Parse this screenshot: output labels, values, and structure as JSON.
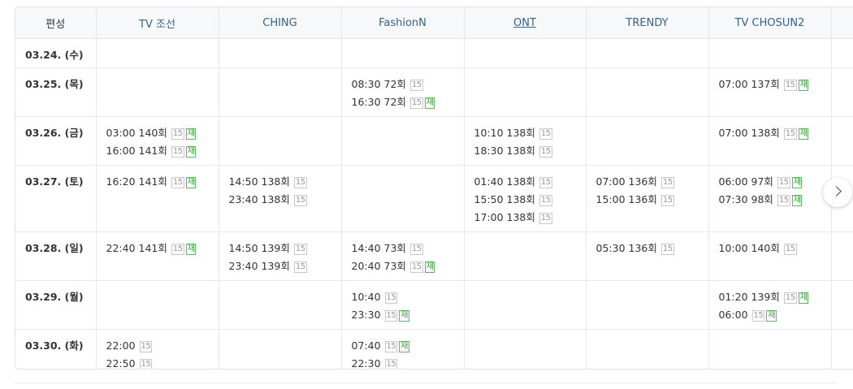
{
  "header": {
    "label": "편성",
    "channels": [
      "TV 조선",
      "CHING",
      "FashionN",
      "ONT",
      "TRENDY",
      "TV CHOSUN2",
      ""
    ]
  },
  "rows": [
    {
      "date": "03.24. (수)",
      "cells": [
        [],
        [],
        [],
        [],
        [],
        [],
        []
      ]
    },
    {
      "date": "03.25. (목)",
      "cells": [
        [],
        [],
        [
          {
            "time": "08:30",
            "ep": "72회",
            "rating": "15"
          },
          {
            "time": "16:30",
            "ep": "72회",
            "rating": "15",
            "rerun": "재"
          }
        ],
        [],
        [],
        [
          {
            "time": "07:00",
            "ep": "137회",
            "rating": "15",
            "rerun": "재"
          }
        ],
        []
      ]
    },
    {
      "date": "03.26. (금)",
      "cells": [
        [
          {
            "time": "03:00",
            "ep": "140회",
            "rating": "15",
            "rerun": "재"
          },
          {
            "time": "16:00",
            "ep": "141회",
            "rating": "15",
            "rerun": "재"
          }
        ],
        [],
        [],
        [
          {
            "time": "10:10",
            "ep": "138회",
            "rating": "15"
          },
          {
            "time": "18:30",
            "ep": "138회",
            "rating": "15"
          }
        ],
        [],
        [
          {
            "time": "07:00",
            "ep": "138회",
            "rating": "15",
            "rerun": "재"
          }
        ],
        []
      ]
    },
    {
      "date": "03.27. (토)",
      "cells": [
        [
          {
            "time": "16:20",
            "ep": "141회",
            "rating": "15",
            "rerun": "재"
          }
        ],
        [
          {
            "time": "14:50",
            "ep": "138회",
            "rating": "15"
          },
          {
            "time": "23:40",
            "ep": "138회",
            "rating": "15"
          }
        ],
        [],
        [
          {
            "time": "01:40",
            "ep": "138회",
            "rating": "15"
          },
          {
            "time": "15:50",
            "ep": "138회",
            "rating": "15"
          },
          {
            "time": "17:00",
            "ep": "138회",
            "rating": "15"
          }
        ],
        [
          {
            "time": "07:00",
            "ep": "136회",
            "rating": "15"
          },
          {
            "time": "15:00",
            "ep": "136회",
            "rating": "15"
          }
        ],
        [
          {
            "time": "06:00",
            "ep": "97회",
            "rating": "15",
            "rerun": "재"
          },
          {
            "time": "07:30",
            "ep": "98회",
            "rating": "15",
            "rerun": "재"
          }
        ],
        []
      ]
    },
    {
      "date": "03.28. (일)",
      "cells": [
        [
          {
            "time": "22:40",
            "ep": "141회",
            "rating": "15",
            "rerun": "재"
          }
        ],
        [
          {
            "time": "14:50",
            "ep": "139회",
            "rating": "15"
          },
          {
            "time": "23:40",
            "ep": "139회",
            "rating": "15"
          }
        ],
        [
          {
            "time": "14:40",
            "ep": "73회",
            "rating": "15"
          },
          {
            "time": "20:40",
            "ep": "73회",
            "rating": "15",
            "rerun": "재"
          }
        ],
        [],
        [
          {
            "time": "05:30",
            "ep": "136회",
            "rating": "15"
          }
        ],
        [
          {
            "time": "10:00",
            "ep": "140회",
            "rating": "15"
          }
        ],
        []
      ]
    },
    {
      "date": "03.29. (월)",
      "cells": [
        [],
        [],
        [
          {
            "time": "10:40",
            "ep": "",
            "rating": "15"
          },
          {
            "time": "23:30",
            "ep": "",
            "rating": "15",
            "rerun": "재"
          }
        ],
        [],
        [],
        [
          {
            "time": "01:20",
            "ep": "139회",
            "rating": "15",
            "rerun": "재"
          },
          {
            "time": "06:00",
            "ep": "",
            "rating": "15",
            "rerun": "재"
          }
        ],
        []
      ]
    },
    {
      "date": "03.30. (화)",
      "cells": [
        [
          {
            "time": "22:00",
            "ep": "",
            "rating": "15"
          },
          {
            "time": "22:50",
            "ep": "",
            "rating": "15"
          }
        ],
        [],
        [
          {
            "time": "07:40",
            "ep": "",
            "rating": "15",
            "rerun": "재"
          },
          {
            "time": "22:30",
            "ep": "",
            "rating": "15"
          }
        ],
        [],
        [],
        [],
        []
      ]
    }
  ],
  "nav": {
    "next_icon": "chevron-right-icon"
  },
  "colors": {
    "header_link": "#35628f",
    "rerun_badge": "#3da33d",
    "rating_badge": "#999999"
  }
}
